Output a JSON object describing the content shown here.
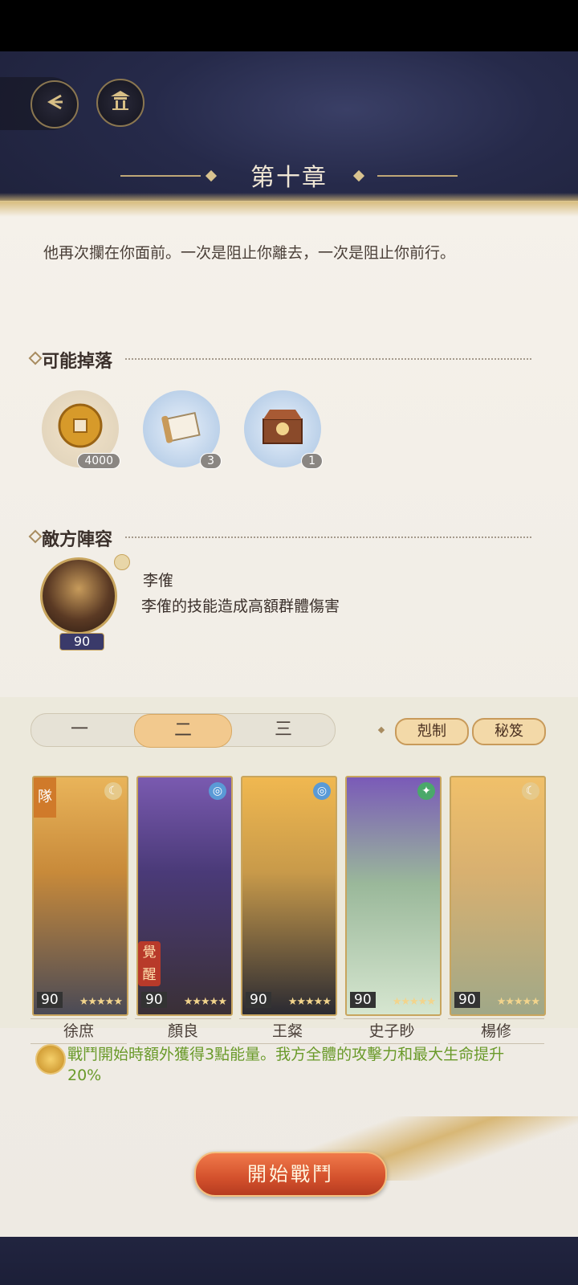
{
  "header": {
    "back_icon": "back-arrow-icon",
    "home_icon": "pavilion-icon",
    "chapter_title": "第十章"
  },
  "stage": {
    "description": "他再次攔在你面前。一次是阻止你離去，一次是阻止你前行。"
  },
  "drops": {
    "title": "可能掉落",
    "items": [
      {
        "icon": "copper-coin-icon",
        "count": "4000"
      },
      {
        "icon": "scroll-icon",
        "count": "3"
      },
      {
        "icon": "treasure-chest-icon",
        "count": "1"
      }
    ]
  },
  "enemy": {
    "title": "敵方陣容",
    "name": "李傕",
    "description": "李傕的技能造成高額群體傷害",
    "level": "90"
  },
  "team": {
    "tabs": [
      "一",
      "二",
      "三"
    ],
    "active_tab": 1,
    "counter_label": "剋制",
    "secret_label": "秘笈",
    "captain_tag": "隊",
    "awake_tag": "覺醒",
    "members": [
      {
        "name": "徐庶",
        "level": "90",
        "stars": 5,
        "element": "moon",
        "bg": "#e0a64a"
      },
      {
        "name": "顏良",
        "level": "90",
        "stars": 5,
        "element": "water",
        "bg": "#6a4fa0"
      },
      {
        "name": "王粲",
        "level": "90",
        "stars": 5,
        "element": "water",
        "bg": "#e6ad48"
      },
      {
        "name": "史子眇",
        "level": "90",
        "stars": 5,
        "element": "wind",
        "bg": "#6c55a8"
      },
      {
        "name": "楊修",
        "level": "90",
        "stars": 5,
        "element": "moon",
        "bg": "#e5b058"
      }
    ]
  },
  "buff": {
    "text": "戰鬥開始時額外獲得3點能量。我方全體的攻擊力和最大生命提升20%"
  },
  "start_button": "開始戰鬥",
  "colors": {
    "accent_gold": "#c8a55e",
    "start_red": "#d3502c",
    "buff_green": "#6a9a2a"
  }
}
